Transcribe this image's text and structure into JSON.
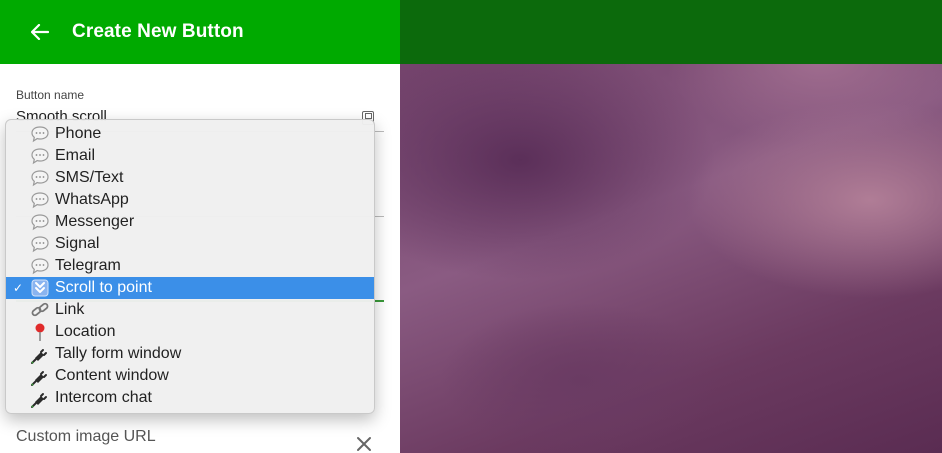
{
  "app_bar": {
    "title": "Create New Button",
    "color": "#00aa00"
  },
  "form": {
    "button_name_label": "Button name",
    "button_name_value": "Smooth scroll",
    "custom_image_label": "Custom image URL"
  },
  "dropdown": {
    "selected_index": 7,
    "accent": "#3b8fe8",
    "options": [
      {
        "label": "Phone",
        "icon": "speech-bubble-icon"
      },
      {
        "label": "Email",
        "icon": "speech-bubble-icon"
      },
      {
        "label": "SMS/Text",
        "icon": "speech-bubble-icon"
      },
      {
        "label": "WhatsApp",
        "icon": "speech-bubble-icon"
      },
      {
        "label": "Messenger",
        "icon": "speech-bubble-icon"
      },
      {
        "label": "Signal",
        "icon": "speech-bubble-icon"
      },
      {
        "label": "Telegram",
        "icon": "speech-bubble-icon"
      },
      {
        "label": "Scroll to point",
        "icon": "scroll-down-icon"
      },
      {
        "label": "Link",
        "icon": "link-icon"
      },
      {
        "label": "Location",
        "icon": "location-pin-icon"
      },
      {
        "label": "Tally form window",
        "icon": "plug-icon"
      },
      {
        "label": "Content window",
        "icon": "plug-icon"
      },
      {
        "label": "Intercom chat",
        "icon": "plug-icon"
      }
    ]
  }
}
